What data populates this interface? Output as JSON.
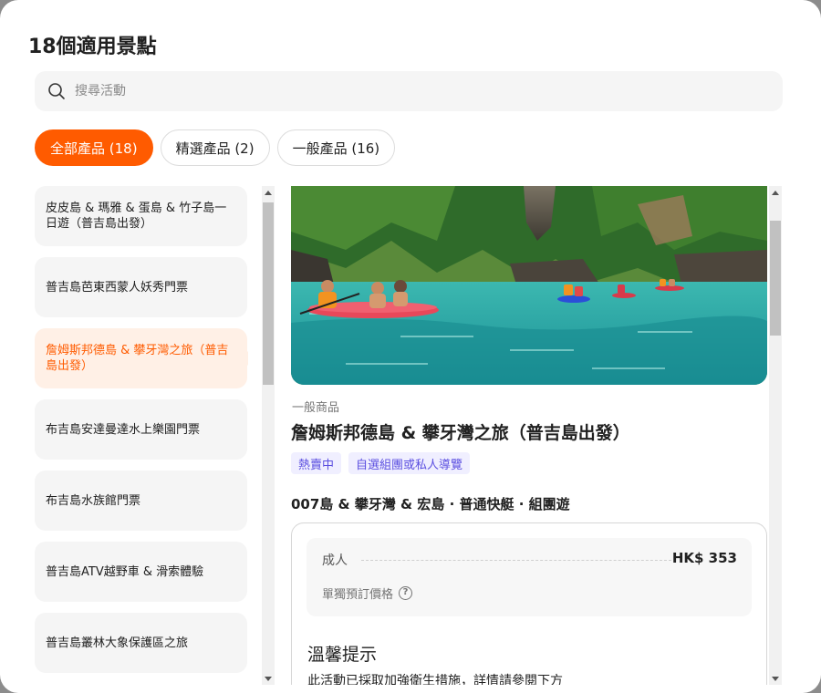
{
  "modal": {
    "title": "18個適用景點"
  },
  "search": {
    "placeholder": "搜尋活動",
    "icon": "search-icon"
  },
  "tabs": [
    {
      "label": "全部產品 (18)",
      "active": true
    },
    {
      "label": "精選產品 (2)",
      "active": false
    },
    {
      "label": "一般產品 (16)",
      "active": false
    }
  ],
  "attractions": [
    {
      "label": "皮皮島 & 瑪雅 & 蛋島 & 竹子島一日遊（普吉島出發）"
    },
    {
      "label": "普吉島芭東西蒙人妖秀門票"
    },
    {
      "label": "詹姆斯邦德島 & 攀牙灣之旅（普吉島出發）",
      "active": true
    },
    {
      "label": "布吉島安達曼達水上樂園門票"
    },
    {
      "label": "布吉島水族館門票"
    },
    {
      "label": "普吉島ATV越野車 & 滑索體驗"
    },
    {
      "label": "普吉島叢林大象保護區之旅"
    }
  ],
  "detail": {
    "category": "一般商品",
    "title": "詹姆斯邦德島 & 攀牙灣之旅（普吉島出發）",
    "badges": [
      "熱賣中",
      "自選組團或私人導覽"
    ],
    "package_name": "007島 & 攀牙灣 & 宏島 · 普通快艇 · 組團遊",
    "price": {
      "label": "成人",
      "value": "HK$ 353",
      "note": "單獨預訂價格",
      "note_icon": "question-icon"
    },
    "notice": {
      "title": "溫馨提示",
      "text": "此活動已採取加強衛生措施，詳情請參閱下方"
    }
  },
  "colors": {
    "accent": "#ff5b00",
    "active_item_bg": "#fff0e6",
    "badge_bg": "#f0efff",
    "badge_text": "#5b4fe0"
  }
}
